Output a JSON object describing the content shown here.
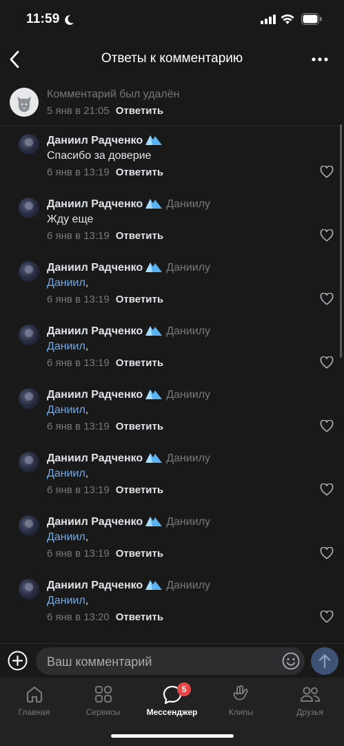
{
  "status": {
    "time": "11:59"
  },
  "header": {
    "title": "Ответы к комментарию"
  },
  "parent_comment": {
    "text": "Комментарий был удалён",
    "date": "5 янв в 21:05",
    "reply_label": "Ответить"
  },
  "replies": [
    {
      "author": "Даниил Радченко",
      "reply_to": "",
      "text": "Спасибо за доверие",
      "mention": "",
      "date": "6 янв в 13:19",
      "reply_label": "Ответить"
    },
    {
      "author": "Даниил Радченко",
      "reply_to": "Даниилу",
      "text": "Жду еще",
      "mention": "",
      "date": "6 янв в 13:19",
      "reply_label": "Ответить"
    },
    {
      "author": "Даниил Радченко",
      "reply_to": "Даниилу",
      "text": ",",
      "mention": "Даниил",
      "date": "6 янв в 13:19",
      "reply_label": "Ответить"
    },
    {
      "author": "Даниил Радченко",
      "reply_to": "Даниилу",
      "text": ",",
      "mention": "Даниил",
      "date": "6 янв в 13:19",
      "reply_label": "Ответить"
    },
    {
      "author": "Даниил Радченко",
      "reply_to": "Даниилу",
      "text": ",",
      "mention": "Даниил",
      "date": "6 янв в 13:19",
      "reply_label": "Ответить"
    },
    {
      "author": "Даниил Радченко",
      "reply_to": "Даниилу",
      "text": ",",
      "mention": "Даниил",
      "date": "6 янв в 13:19",
      "reply_label": "Ответить"
    },
    {
      "author": "Даниил Радченко",
      "reply_to": "Даниилу",
      "text": ",",
      "mention": "Даниил",
      "date": "6 янв в 13:19",
      "reply_label": "Ответить"
    },
    {
      "author": "Даниил Радченко",
      "reply_to": "Даниилу",
      "text": ",",
      "mention": "Даниил",
      "date": "6 янв в 13:20",
      "reply_label": "Ответить"
    }
  ],
  "composer": {
    "placeholder": "Ваш комментарий"
  },
  "tabbar": {
    "tabs": [
      {
        "label": "Главная",
        "icon": "home-icon"
      },
      {
        "label": "Сервисы",
        "icon": "services-icon"
      },
      {
        "label": "Мессенджер",
        "icon": "messenger-icon",
        "active": true
      },
      {
        "label": "Клипы",
        "icon": "clips-icon"
      },
      {
        "label": "Друзья",
        "icon": "friends-icon"
      }
    ],
    "messenger_badge": "5"
  },
  "colors": {
    "accent": "#71aaeb",
    "background": "#19191a",
    "badge": "#e64646",
    "send": "#3d5274"
  }
}
